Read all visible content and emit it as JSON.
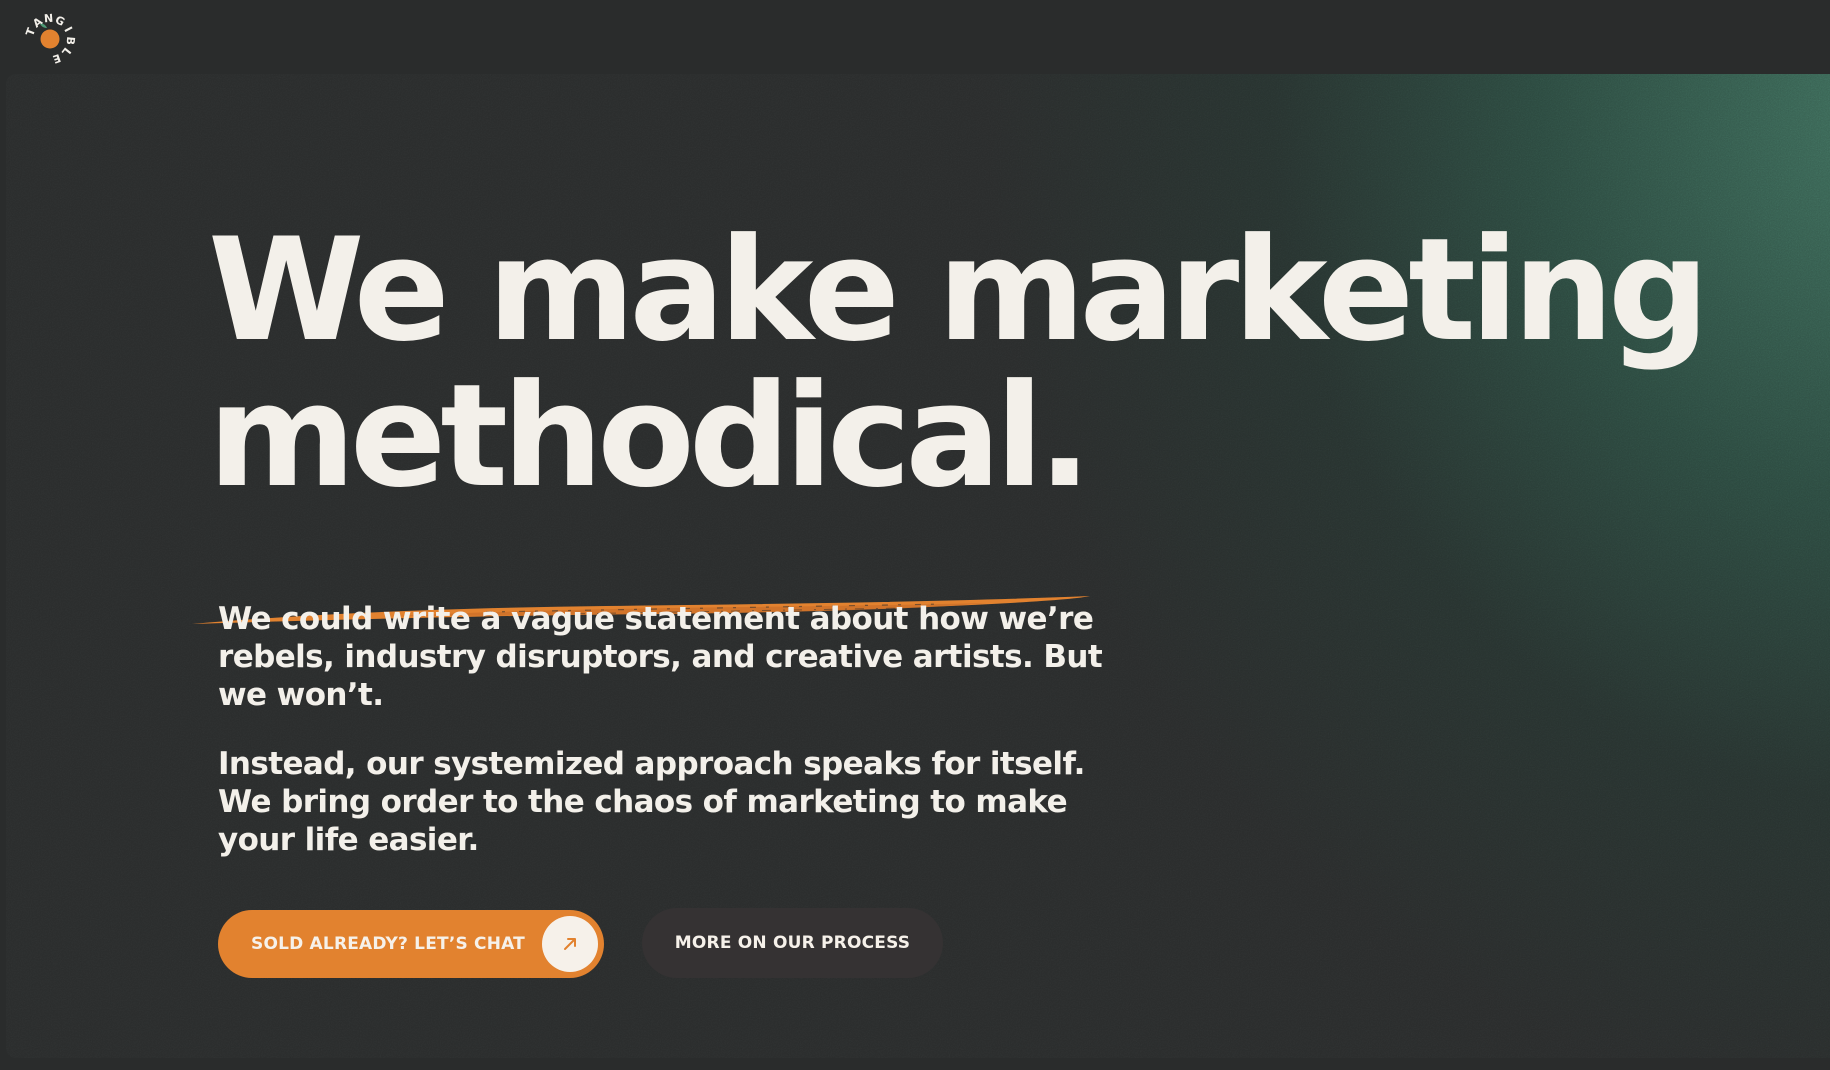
{
  "brand": {
    "logo_text": "TANGIBLE",
    "logo_letters": [
      "T",
      "A",
      "N",
      "G",
      "I",
      "B",
      "L",
      "E"
    ],
    "accent_color": "#e2822f",
    "leaf_color": "#4e9a76"
  },
  "hero": {
    "headline_line1": "We make marketing",
    "headline_line2": "methodical.",
    "paragraph1": "We could write a vague statement about how we’re rebels, industry disruptors, and creative artists. But we won’t.",
    "paragraph2": "Instead, our systemized approach speaks for itself. We bring order to the chaos of marketing to make your life easier."
  },
  "actions": {
    "primary_label": "SOLD ALREADY? LET’S CHAT",
    "primary_icon": "arrow-up-right-icon",
    "secondary_label": "MORE ON OUR PROCESS"
  },
  "colors": {
    "background": "#2a2c2c",
    "text": "#f3f0ea",
    "gradient_green": "#3e6e5c",
    "secondary_button": "#353233"
  }
}
